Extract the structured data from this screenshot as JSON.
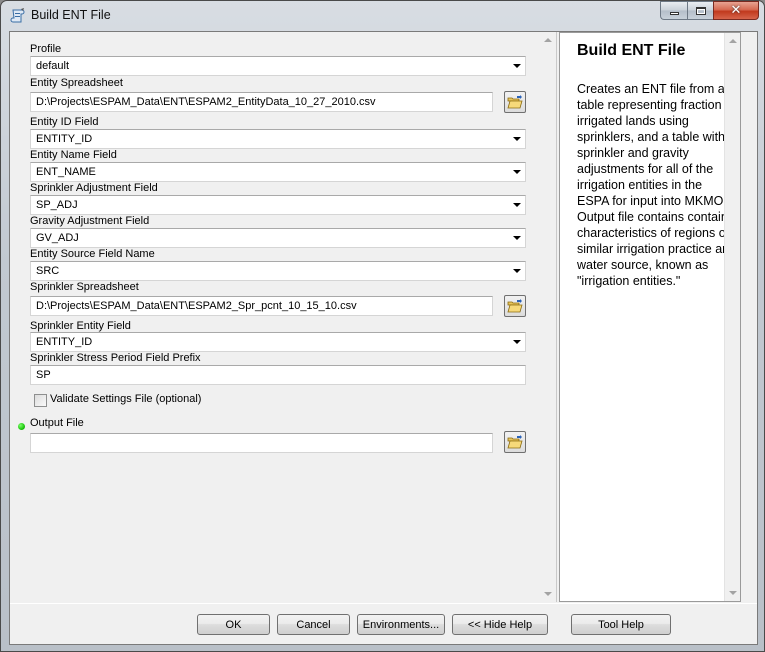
{
  "window": {
    "title": "Build ENT File",
    "icon": "tool-script-icon",
    "controls": {
      "minimize": "minimize",
      "maximize": "maximize",
      "close": "close"
    }
  },
  "form": {
    "fields": [
      {
        "label": "Profile",
        "type": "combo",
        "value": "default"
      },
      {
        "label": "Entity Spreadsheet",
        "type": "path",
        "value": "D:\\Projects\\ESPAM_Data\\ENT\\ESPAM2_EntityData_10_27_2010.csv"
      },
      {
        "label": "Entity ID Field",
        "type": "combo",
        "value": "ENTITY_ID"
      },
      {
        "label": "Entity Name Field",
        "type": "combo",
        "value": "ENT_NAME"
      },
      {
        "label": "Sprinkler Adjustment Field",
        "type": "combo",
        "value": "SP_ADJ"
      },
      {
        "label": "Gravity Adjustment Field",
        "type": "combo",
        "value": "GV_ADJ"
      },
      {
        "label": "Entity Source Field Name",
        "type": "combo",
        "value": "SRC"
      },
      {
        "label": "Sprinkler Spreadsheet",
        "type": "path",
        "value": "D:\\Projects\\ESPAM_Data\\ENT\\ESPAM2_Spr_pcnt_10_15_10.csv"
      },
      {
        "label": "Sprinkler Entity Field",
        "type": "combo",
        "value": "ENTITY_ID"
      },
      {
        "label": "Sprinkler Stress Period Field Prefix",
        "type": "text",
        "value": "SP"
      }
    ],
    "validate_checkbox": {
      "label": "Validate Settings File (optional)",
      "checked": false
    },
    "output_file": {
      "label": "Output File",
      "value": "",
      "required": true,
      "required_color": "#1ec70f"
    }
  },
  "help": {
    "title": "Build ENT File",
    "body": "Creates an ENT file from a table representing fraction of irrigated lands using sprinklers, and a table with sprinkler and gravity adjustments for all of the irrigation entities in the ESPA for input into MKMOD. Output file contains contains characteristics of regions of similar irrigation practice and water source, known as \"irrigation entities.\""
  },
  "buttons": {
    "ok": "OK",
    "cancel": "Cancel",
    "environments": "Environments...",
    "hide_help": "<< Hide Help",
    "tool_help": "Tool Help"
  }
}
